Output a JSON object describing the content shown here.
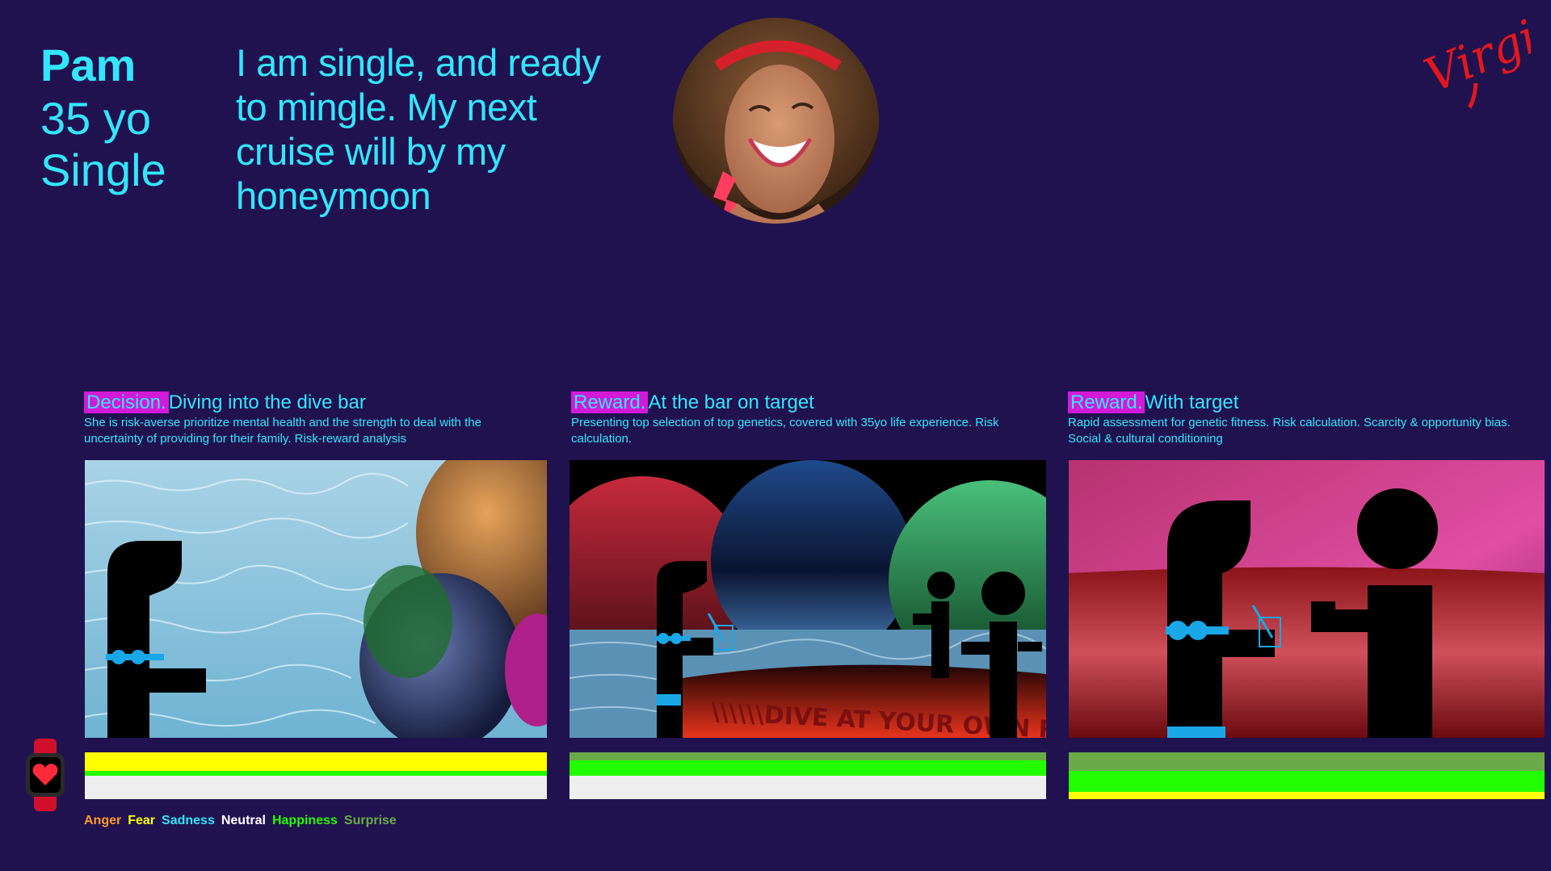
{
  "persona": {
    "name": "Pam",
    "age": "35 yo",
    "status": "Single",
    "quote": "I am single, and ready to mingle. My next cruise will by my honeymoon"
  },
  "brand": {
    "logo_text": "Virgin",
    "color": "#e3161e"
  },
  "panels": [
    {
      "tag": "Decision.",
      "title": "Diving into the dive bar",
      "description": "She is risk-averse prioritize mental health and the strength to deal with the uncertainty of providing for their family. Risk-reward analysis",
      "emotions": [
        {
          "emotion": "Fear",
          "color": "#ffff00",
          "share": 0.4
        },
        {
          "emotion": "Happiness",
          "color": "#22ff00",
          "share": 0.1
        },
        {
          "emotion": "Neutral",
          "color": "#eeeeee",
          "share": 0.5
        }
      ]
    },
    {
      "tag": "Reward.",
      "title": "At the bar on target",
      "description": "Presenting top selection of top genetics, covered with 35yo  life experience. Risk calculation.",
      "emotions": [
        {
          "emotion": "Surprise",
          "color": "#6aaa48",
          "share": 0.18
        },
        {
          "emotion": "Happiness",
          "color": "#22ff00",
          "share": 0.32
        },
        {
          "emotion": "Neutral",
          "color": "#eeeeee",
          "share": 0.5
        }
      ]
    },
    {
      "tag": "Reward.",
      "title": "With target",
      "description": "Rapid assessment for genetic fitness. Risk calculation. Scarcity & opportunity bias. Social & cultural conditioning",
      "emotions": [
        {
          "emotion": "Surprise",
          "color": "#6aaa48",
          "share": 0.4
        },
        {
          "emotion": "Happiness",
          "color": "#22ff00",
          "share": 0.45
        },
        {
          "emotion": "Fear",
          "color": "#ffff00",
          "share": 0.15
        }
      ]
    }
  ],
  "scene_sign": "\\\\\\\\\\\\DIVE AT YOUR OWN RISK////",
  "legend": [
    {
      "label": "Anger",
      "color": "#ff9a2e"
    },
    {
      "label": "Fear",
      "color": "#ffff00"
    },
    {
      "label": "Sadness",
      "color": "#33e6ff"
    },
    {
      "label": "Neutral",
      "color": "#ffffff"
    },
    {
      "label": "Happiness",
      "color": "#22ff00"
    },
    {
      "label": "Surprise",
      "color": "#6aaa48"
    }
  ],
  "icons": {
    "watch": "smartwatch-heart-icon",
    "logo": "virgin-logo"
  }
}
